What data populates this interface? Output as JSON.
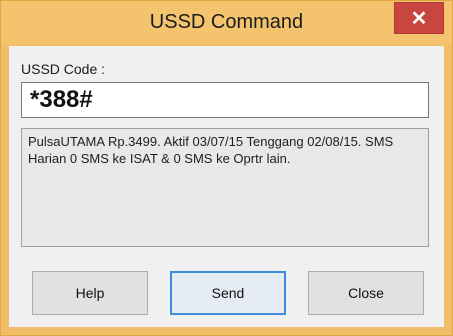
{
  "window": {
    "title": "USSD Command",
    "close_glyph": "✕"
  },
  "form": {
    "code_label": "USSD Code :",
    "code_value": "*388#",
    "response_text": "PulsaUTAMA Rp.3499. Aktif 03/07/15 Tenggang 02/08/15. SMS Harian 0 SMS ke ISAT & 0 SMS ke Oprtr lain."
  },
  "buttons": {
    "help": "Help",
    "send": "Send",
    "close": "Close"
  },
  "colors": {
    "frame": "#f0be66",
    "close_button": "#c8463f",
    "focus_border": "#3c8de0"
  }
}
